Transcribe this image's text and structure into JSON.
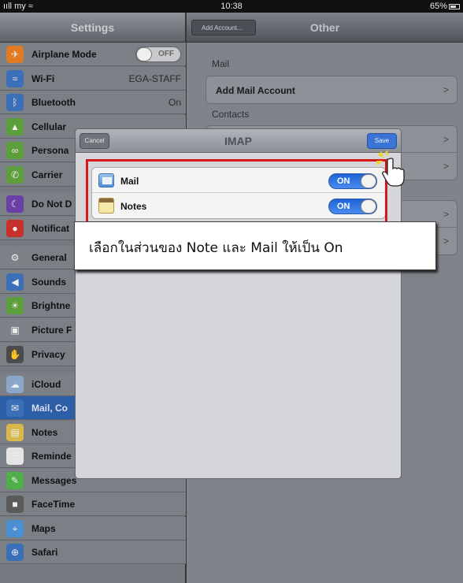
{
  "status": {
    "carrier": "my",
    "time": "10:38",
    "battery": "65%"
  },
  "settings": {
    "title": "Settings",
    "items": [
      {
        "label": "Airplane Mode",
        "value": "OFF",
        "icon": "airplane-icon",
        "color": "#e07a23"
      },
      {
        "label": "Wi-Fi",
        "value": "EGA-STAFF",
        "icon": "wifi-icon",
        "color": "#3b6fb8"
      },
      {
        "label": "Bluetooth",
        "value": "On",
        "icon": "bluetooth-icon",
        "color": "#3b6fb8"
      },
      {
        "label": "Cellular",
        "value": "",
        "icon": "cellular-icon",
        "color": "#5c9f3a"
      },
      {
        "label": "Persona",
        "value": "",
        "icon": "personal-hotspot-icon",
        "color": "#5c9f3a"
      },
      {
        "label": "Carrier",
        "value": "",
        "icon": "phone-icon",
        "color": "#5c9f3a"
      },
      {
        "label": "Do Not D",
        "value": "",
        "icon": "moon-icon",
        "color": "#6b3fa6"
      },
      {
        "label": "Notificat",
        "value": "",
        "icon": "notifications-icon",
        "color": "#c8312b"
      },
      {
        "label": "General",
        "value": "",
        "icon": "gear-icon",
        "color": "#7d8288"
      },
      {
        "label": "Sounds",
        "value": "",
        "icon": "speaker-icon",
        "color": "#3b6fb8"
      },
      {
        "label": "Brightne",
        "value": "",
        "icon": "brightness-icon",
        "color": "#5c9f3a"
      },
      {
        "label": "Picture F",
        "value": "",
        "icon": "picture-frame-icon",
        "color": "#7d8288"
      },
      {
        "label": "Privacy",
        "value": "",
        "icon": "hand-icon",
        "color": "#4b4b4b"
      },
      {
        "label": "iCloud",
        "value": "",
        "icon": "cloud-icon",
        "color": "#8aa6c9"
      },
      {
        "label": "Mail, Co",
        "value": "",
        "icon": "mail-icon",
        "color": "#3b6fb8"
      },
      {
        "label": "Notes",
        "value": "",
        "icon": "notes-icon",
        "color": "#d8b84a"
      },
      {
        "label": "Reminde",
        "value": "",
        "icon": "reminders-icon",
        "color": "#e4e4e4"
      },
      {
        "label": "Messages",
        "value": "",
        "icon": "messages-icon",
        "color": "#4fb04a"
      },
      {
        "label": "FaceTime",
        "value": "",
        "icon": "facetime-icon",
        "color": "#5a5a5a"
      },
      {
        "label": "Maps",
        "value": "",
        "icon": "maps-icon",
        "color": "#4a8fd1"
      },
      {
        "label": "Safari",
        "value": "",
        "icon": "safari-icon",
        "color": "#3b6fb8"
      }
    ]
  },
  "right": {
    "back_label": "Add Account...",
    "title": "Other",
    "mail_header": "Mail",
    "add_mail": "Add Mail Account",
    "contacts_header": "Contacts",
    "chevron": ">"
  },
  "modal": {
    "title": "IMAP",
    "cancel": "Cancel",
    "save": "Save",
    "rows": [
      {
        "label": "Mail",
        "state": "ON"
      },
      {
        "label": "Notes",
        "state": "ON"
      }
    ]
  },
  "callout": "เลือกในส่วนของ Note และ Mail ให้เป็น On"
}
